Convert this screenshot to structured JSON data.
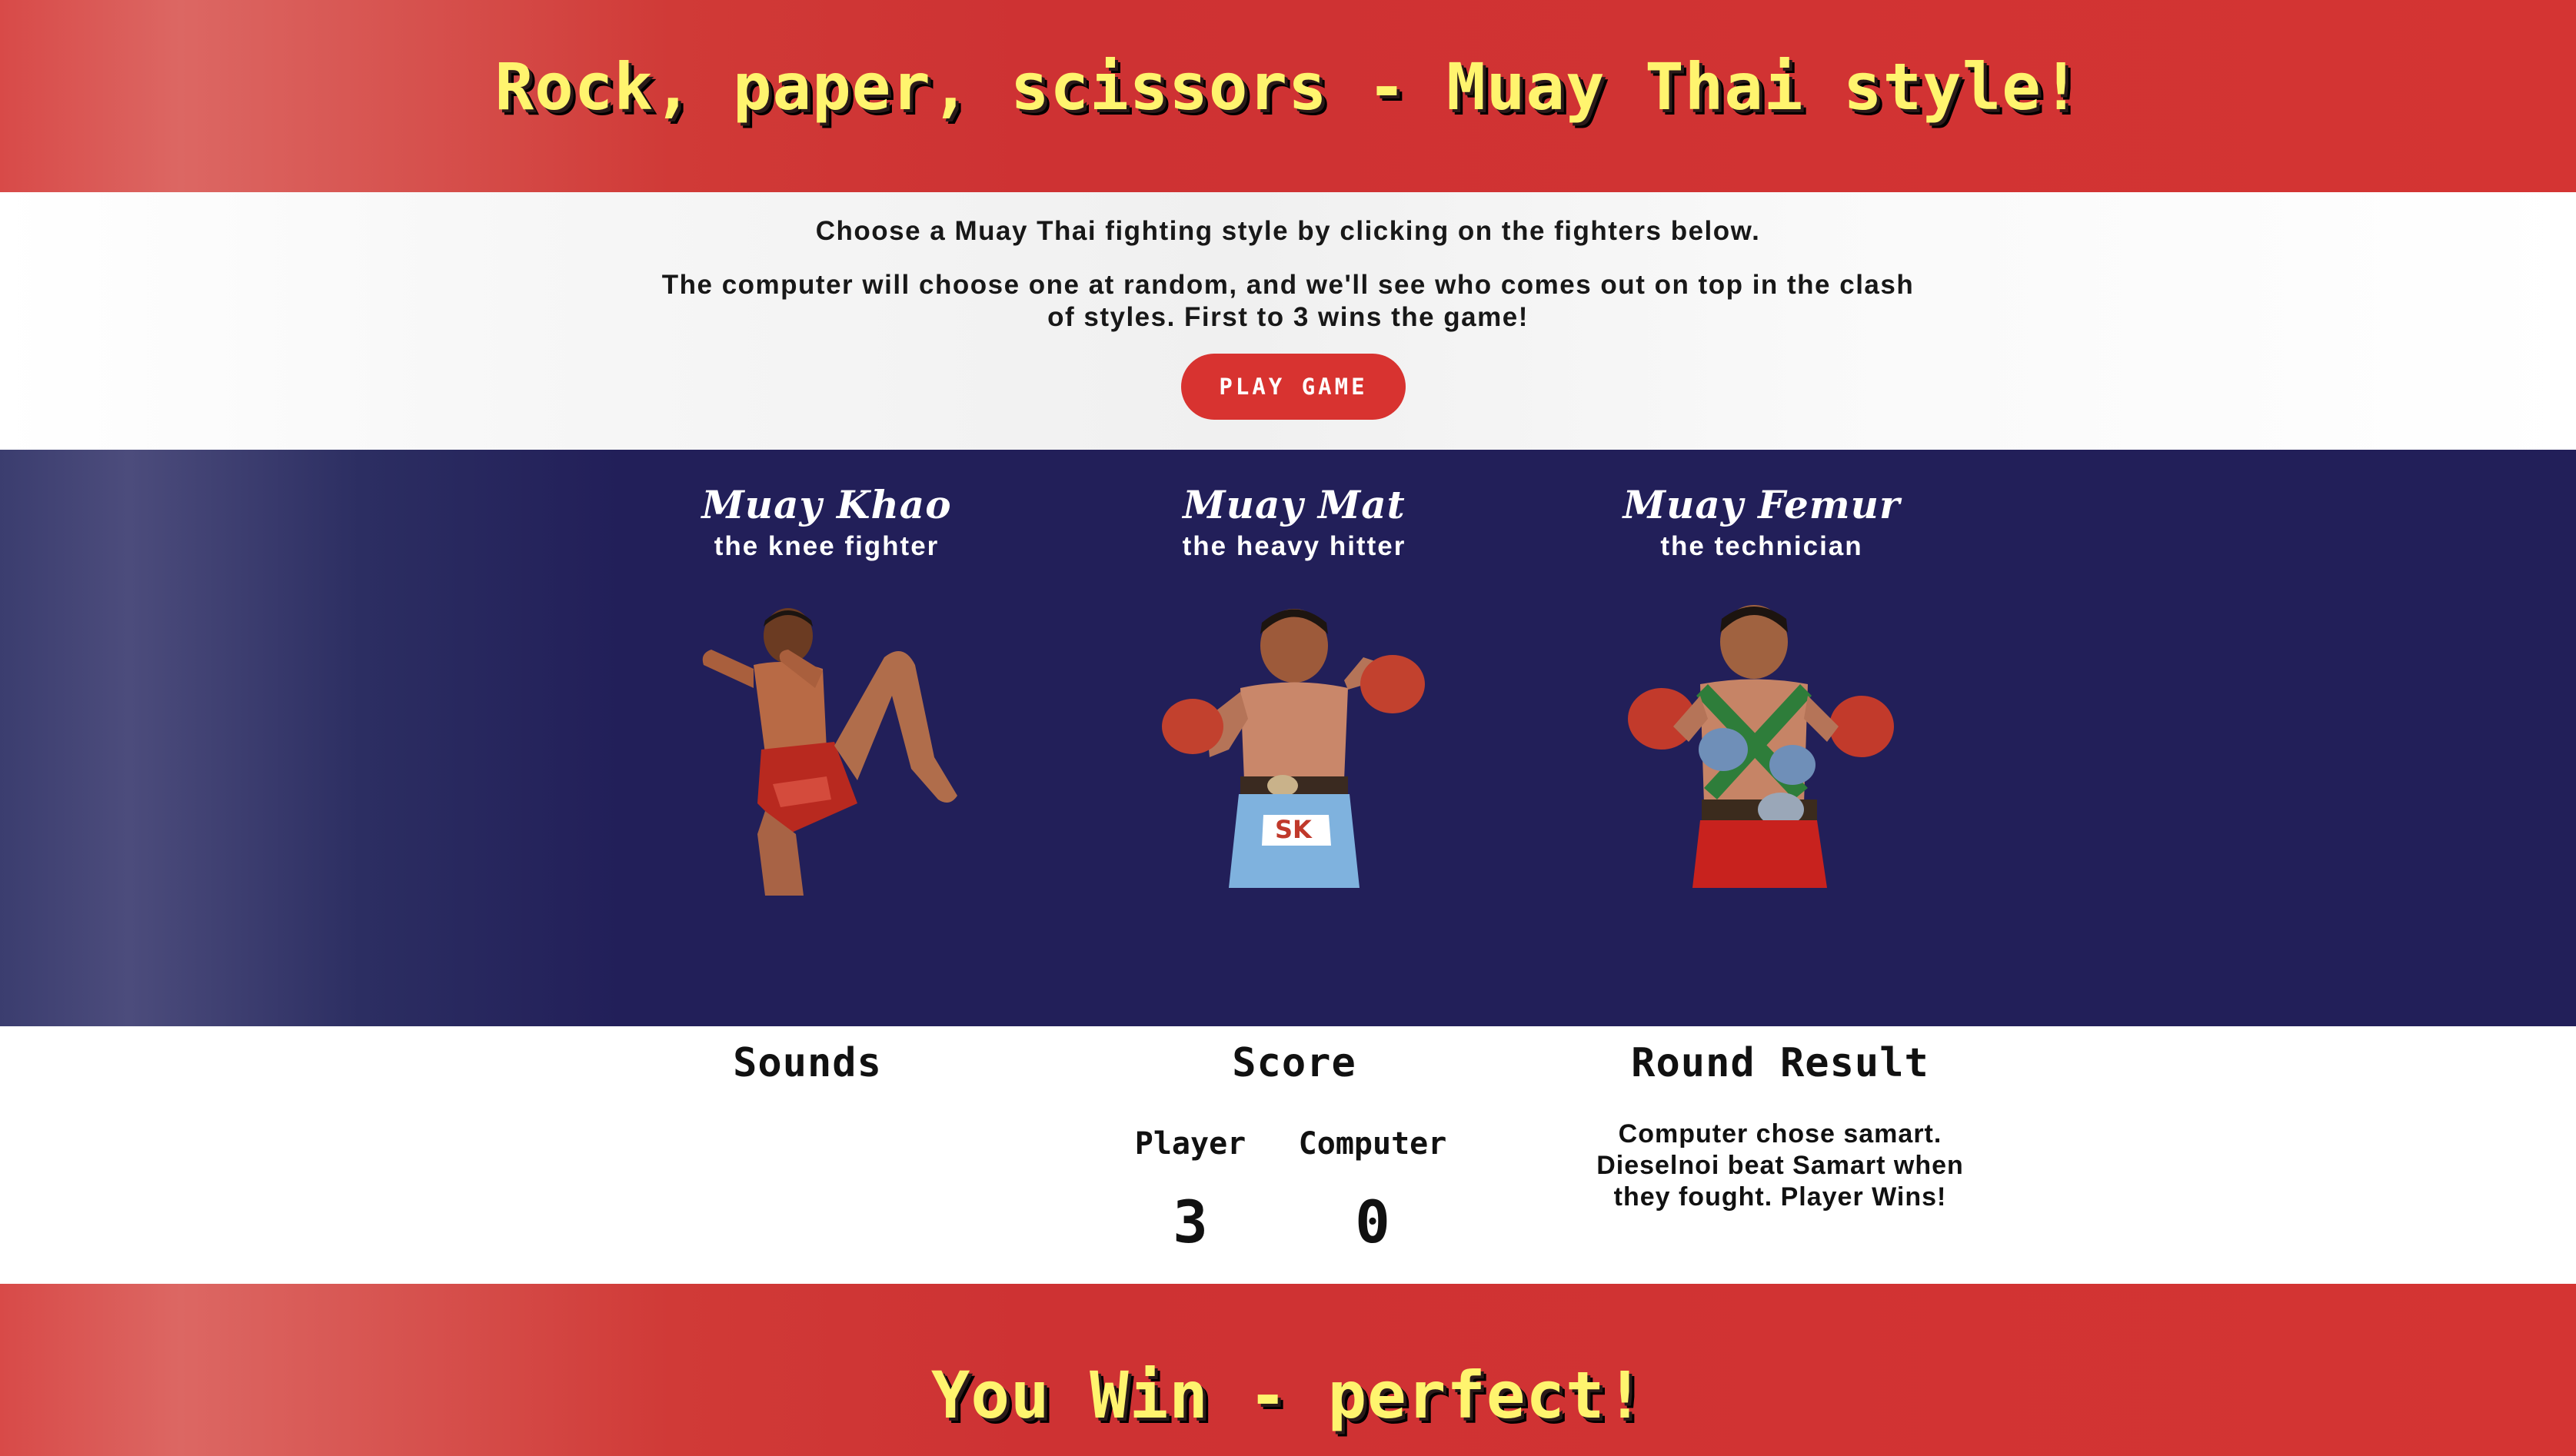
{
  "header": {
    "title": "Rock, paper, scissors - Muay Thai style!"
  },
  "intro": {
    "line1": "Choose a Muay Thai fighting style by clicking on the fighters below.",
    "line2": "The computer will choose one at random, and we'll see who comes out on top in the clash of styles. First to 3 wins the game!",
    "play_button": "PLAY GAME"
  },
  "fighters": [
    {
      "name": "Muay Khao",
      "subtitle": "the knee fighter",
      "icon": "kneeing-fighter-photo"
    },
    {
      "name": "Muay Mat",
      "subtitle": "the heavy hitter",
      "icon": "gloved-fighter-photo"
    },
    {
      "name": "Muay Femur",
      "subtitle": "the technician",
      "icon": "belt-champion-photo"
    }
  ],
  "bottom": {
    "sounds_title": "Sounds",
    "score_title": "Score",
    "player_label": "Player",
    "computer_label": "Computer",
    "player_score": "3",
    "computer_score": "0",
    "result_title": "Round Result",
    "result_text": "Computer chose samart. Dieselnoi beat Samart when they fought. Player Wins!"
  },
  "footer": {
    "message": "You Win - perfect!"
  },
  "colors": {
    "red": "#d43433",
    "blue": "#221f59",
    "title_yellow": "#fff46e",
    "button_red": "#d83330"
  }
}
